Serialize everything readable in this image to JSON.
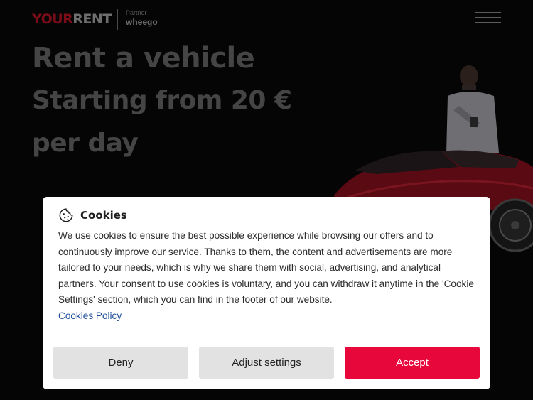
{
  "header": {
    "logo_part1": "YOUR",
    "logo_part2": "RENT",
    "partner_label": "Partner",
    "partner_brand": "wheego",
    "menu_icon": "hamburger-menu-icon"
  },
  "hero": {
    "line1": "Rent a vehicle",
    "line2": "Starting from 20 €",
    "line3": "per day",
    "image": "car-and-person-photo"
  },
  "cookie_dialog": {
    "icon": "cookie-icon",
    "title": "Cookies",
    "body": "We use cookies to ensure the best possible experience while browsing our offers and to continuously improve our service. Thanks to them, the content and advertisements are more tailored to your needs, which is why we share them with social, advertising, and analytical partners. Your consent to use cookies is voluntary, and you can withdraw it anytime in the 'Cookie Settings' section, which you can find in the footer of our website.",
    "policy_link": "Cookies Policy",
    "buttons": {
      "deny": "Deny",
      "adjust": "Adjust settings",
      "accept": "Accept"
    }
  },
  "colors": {
    "accent": "#e8073b",
    "link": "#1f4f9a",
    "background": "#050506"
  }
}
